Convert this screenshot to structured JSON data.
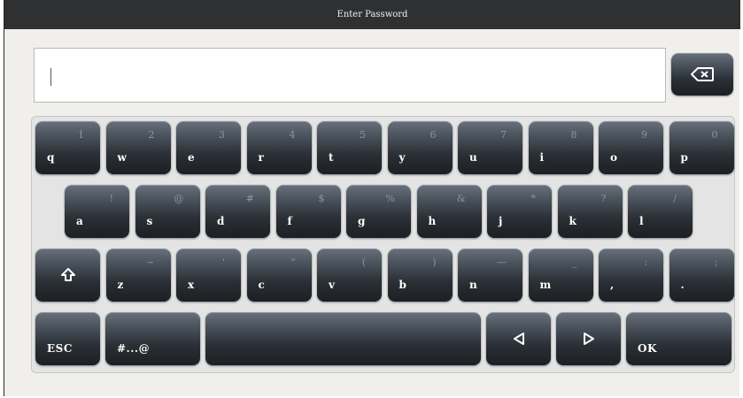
{
  "window": {
    "title": "Enter Password"
  },
  "password_field": {
    "value": ""
  },
  "keyboard": {
    "row1": [
      {
        "main": "q",
        "alt": "1"
      },
      {
        "main": "w",
        "alt": "2"
      },
      {
        "main": "e",
        "alt": "3"
      },
      {
        "main": "r",
        "alt": "4"
      },
      {
        "main": "t",
        "alt": "5"
      },
      {
        "main": "y",
        "alt": "6"
      },
      {
        "main": "u",
        "alt": "7"
      },
      {
        "main": "i",
        "alt": "8"
      },
      {
        "main": "o",
        "alt": "9"
      },
      {
        "main": "p",
        "alt": "0"
      }
    ],
    "row2": [
      {
        "main": "a",
        "alt": "!"
      },
      {
        "main": "s",
        "alt": "@"
      },
      {
        "main": "d",
        "alt": "#"
      },
      {
        "main": "f",
        "alt": "$"
      },
      {
        "main": "g",
        "alt": "%"
      },
      {
        "main": "h",
        "alt": "&"
      },
      {
        "main": "j",
        "alt": "*"
      },
      {
        "main": "k",
        "alt": "?"
      },
      {
        "main": "l",
        "alt": "/"
      }
    ],
    "row3_letters": [
      {
        "main": "z",
        "alt": "~"
      },
      {
        "main": "x",
        "alt": "'"
      },
      {
        "main": "c",
        "alt": "\""
      },
      {
        "main": "v",
        "alt": "("
      },
      {
        "main": "b",
        "alt": ")"
      },
      {
        "main": "n",
        "alt": "—"
      },
      {
        "main": "m",
        "alt": "_"
      },
      {
        "main": ",",
        "alt": ":"
      },
      {
        "main": ".",
        "alt": ";"
      }
    ],
    "shift_icon": "shift-arrow-icon",
    "esc_label": "ESC",
    "symbols_label": "#...@",
    "left_icon": "left-arrow-icon",
    "right_icon": "right-arrow-icon",
    "ok_label": "OK",
    "backspace_icon": "backspace-icon"
  },
  "colors": {
    "titlebar": "#2f3032",
    "key_top": "#68717c",
    "key_bottom": "#1c1f23",
    "alt_text": "#8e959e",
    "background": "#f0efec"
  }
}
